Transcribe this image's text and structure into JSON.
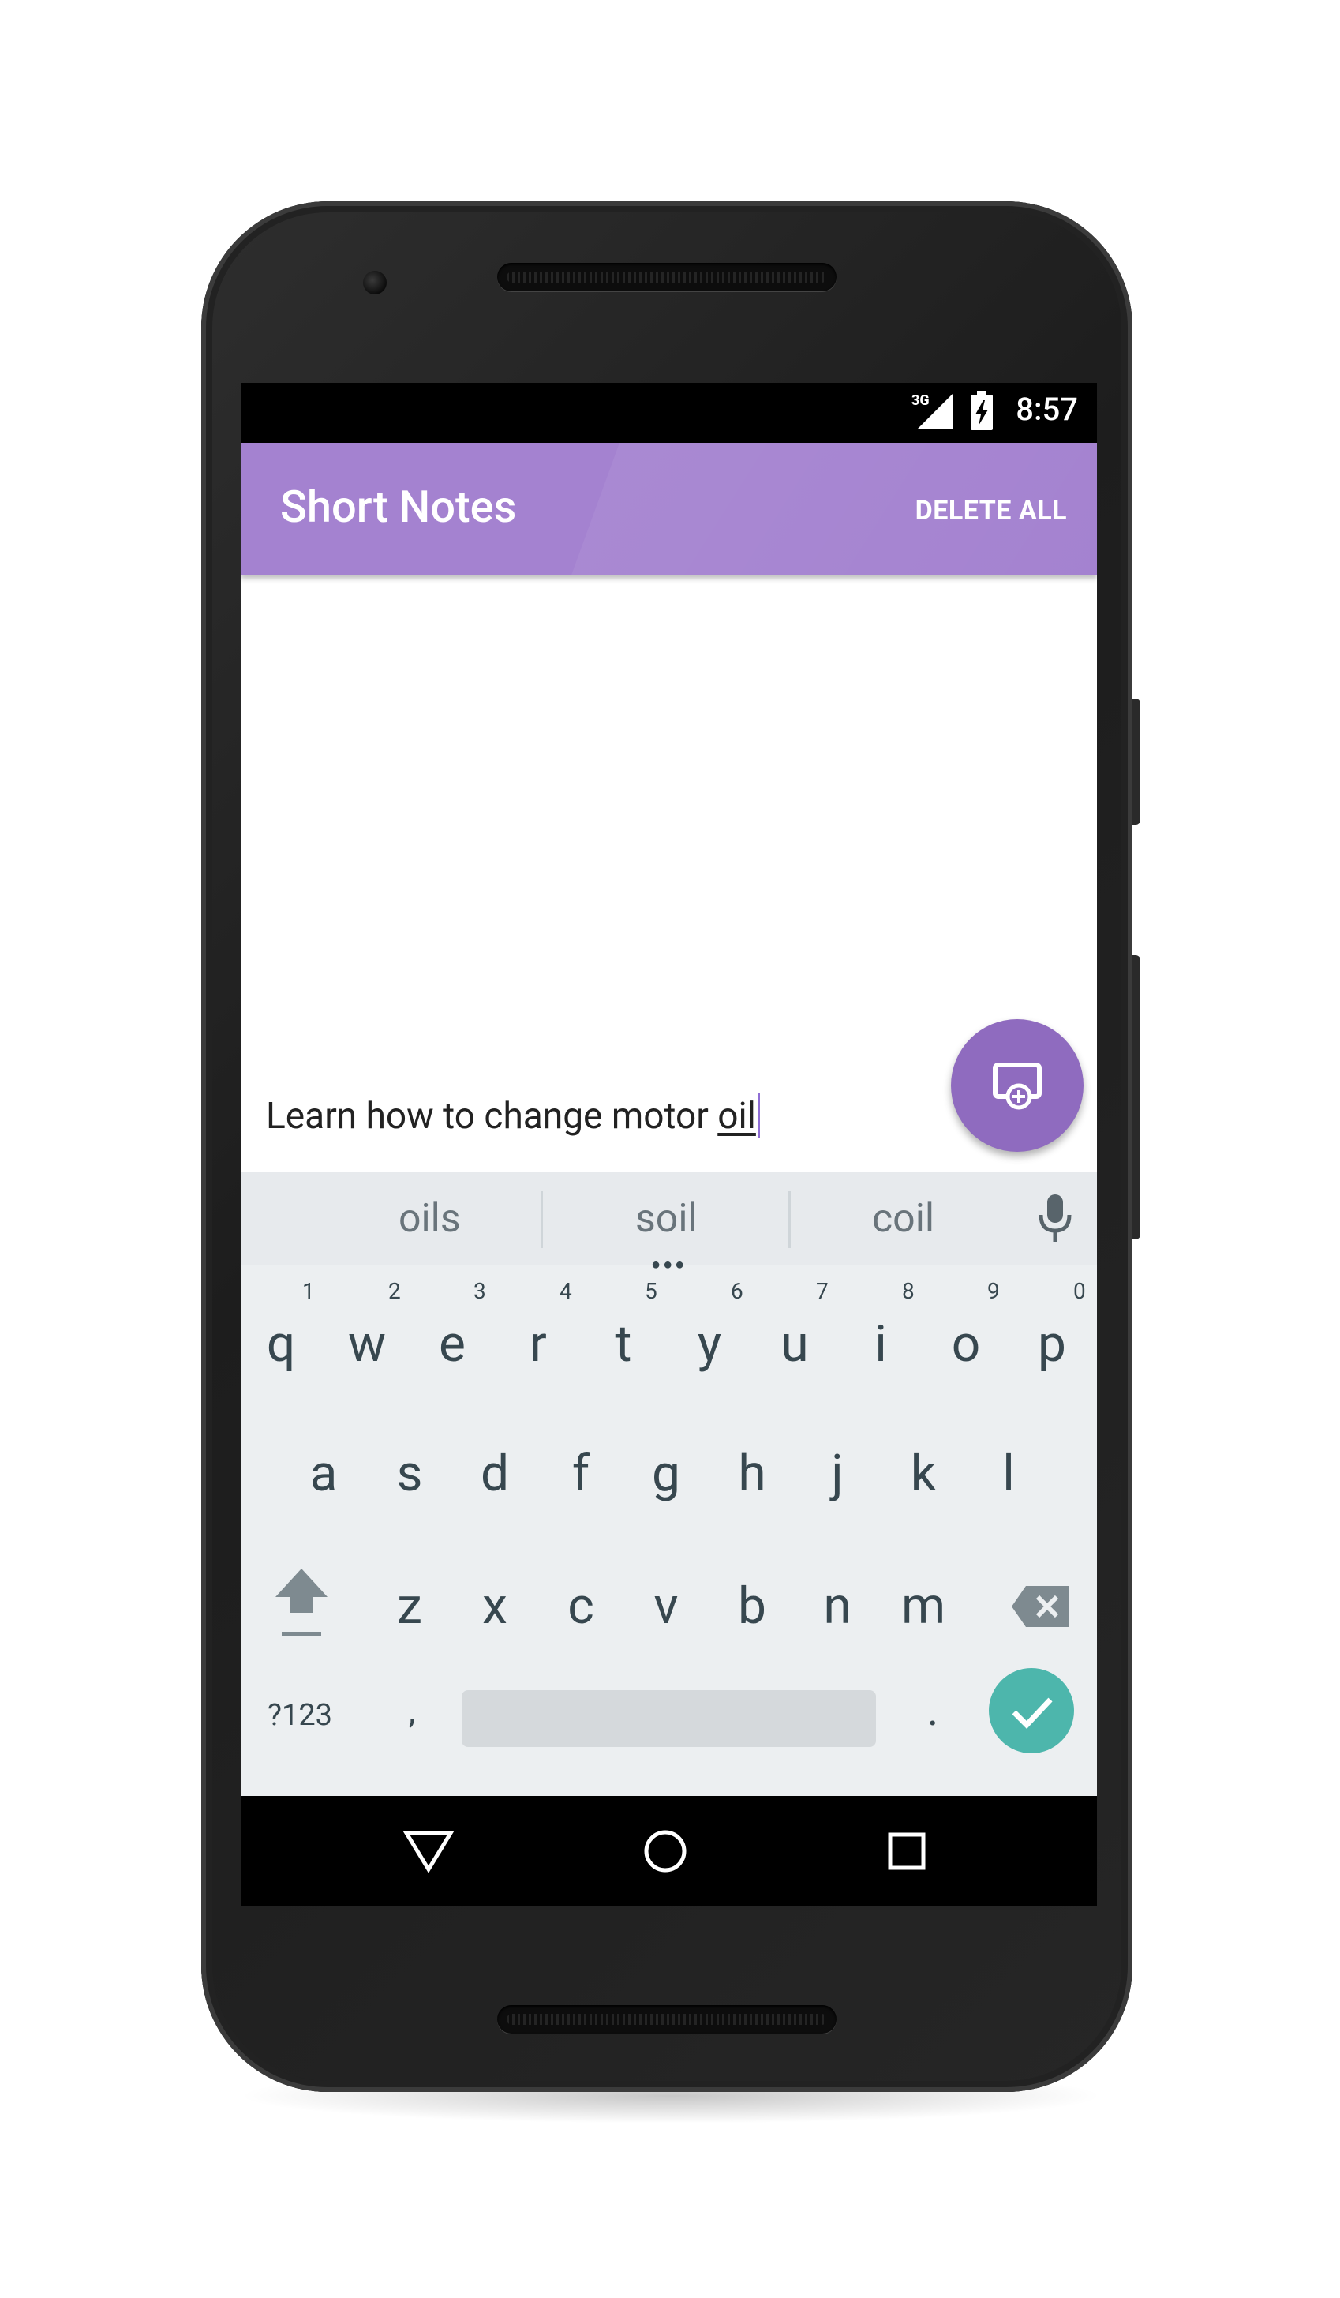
{
  "status_bar": {
    "network": "3G",
    "time": "8:57"
  },
  "app_bar": {
    "title": "Short Notes",
    "action": "DELETE ALL",
    "color": "#a482d0"
  },
  "note_input": {
    "text_before": "Learn how to change motor ",
    "composing_word": "oil"
  },
  "fab": {
    "icon": "add-to-screen-icon",
    "color": "#8f6bbf"
  },
  "keyboard": {
    "suggestions": [
      "oils",
      "soil",
      "coil"
    ],
    "row1": [
      "q",
      "w",
      "e",
      "r",
      "t",
      "y",
      "u",
      "i",
      "o",
      "p"
    ],
    "row1_hints": [
      "1",
      "2",
      "3",
      "4",
      "5",
      "6",
      "7",
      "8",
      "9",
      "0"
    ],
    "row2": [
      "a",
      "s",
      "d",
      "f",
      "g",
      "h",
      "j",
      "k",
      "l"
    ],
    "row3": [
      "z",
      "x",
      "c",
      "v",
      "b",
      "n",
      "m"
    ],
    "symbols_label": "?123",
    "comma": ",",
    "period": ".",
    "enter_color": "#4db6ac"
  },
  "navigation": [
    "back-icon",
    "home-icon",
    "recents-icon"
  ]
}
